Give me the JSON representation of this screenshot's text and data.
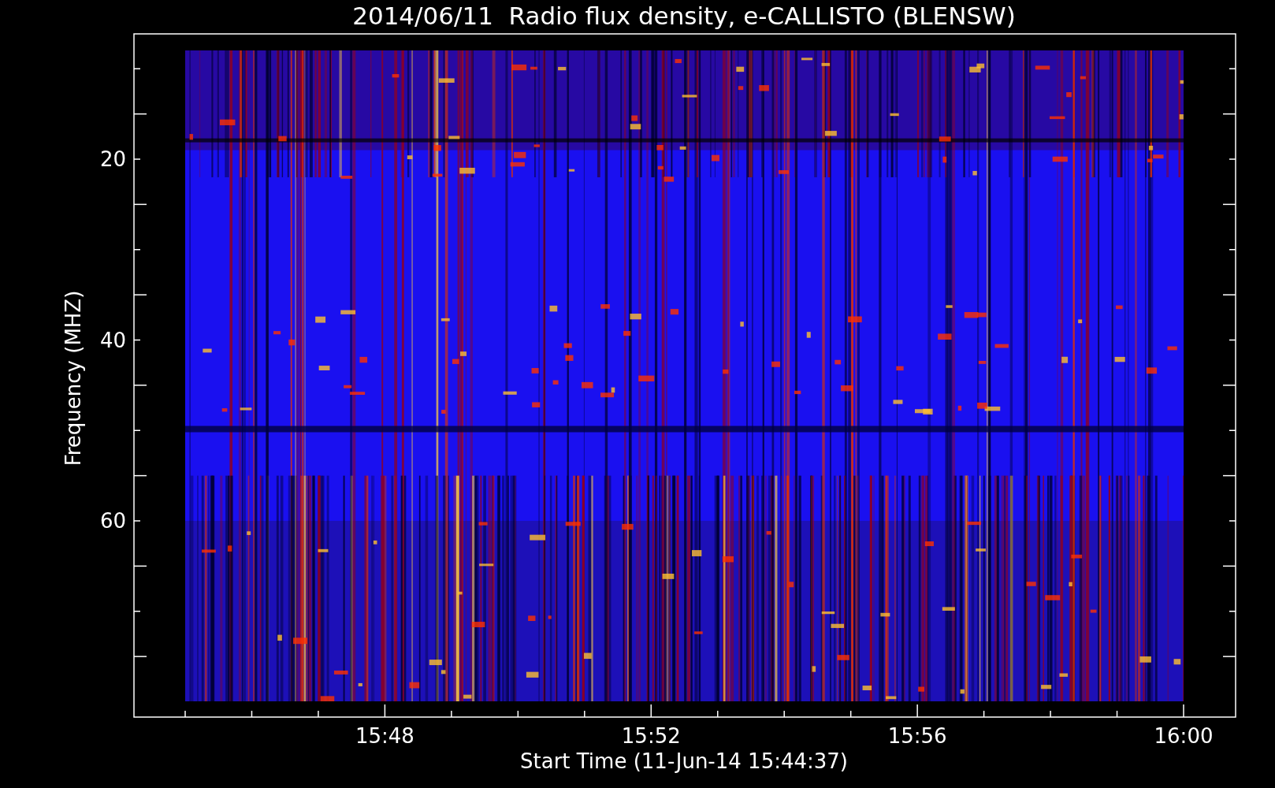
{
  "title": "2014/06/11  Radio flux density, e-CALLISTO (BLENSW)",
  "y_axis": {
    "label": "Frequency (MHZ)",
    "ticks": [
      "20",
      "40",
      "60"
    ]
  },
  "x_axis": {
    "label": "Start Time (11-Jun-14 15:44:37)",
    "ticks": [
      "15:48",
      "15:52",
      "15:56",
      "16:00"
    ]
  }
}
